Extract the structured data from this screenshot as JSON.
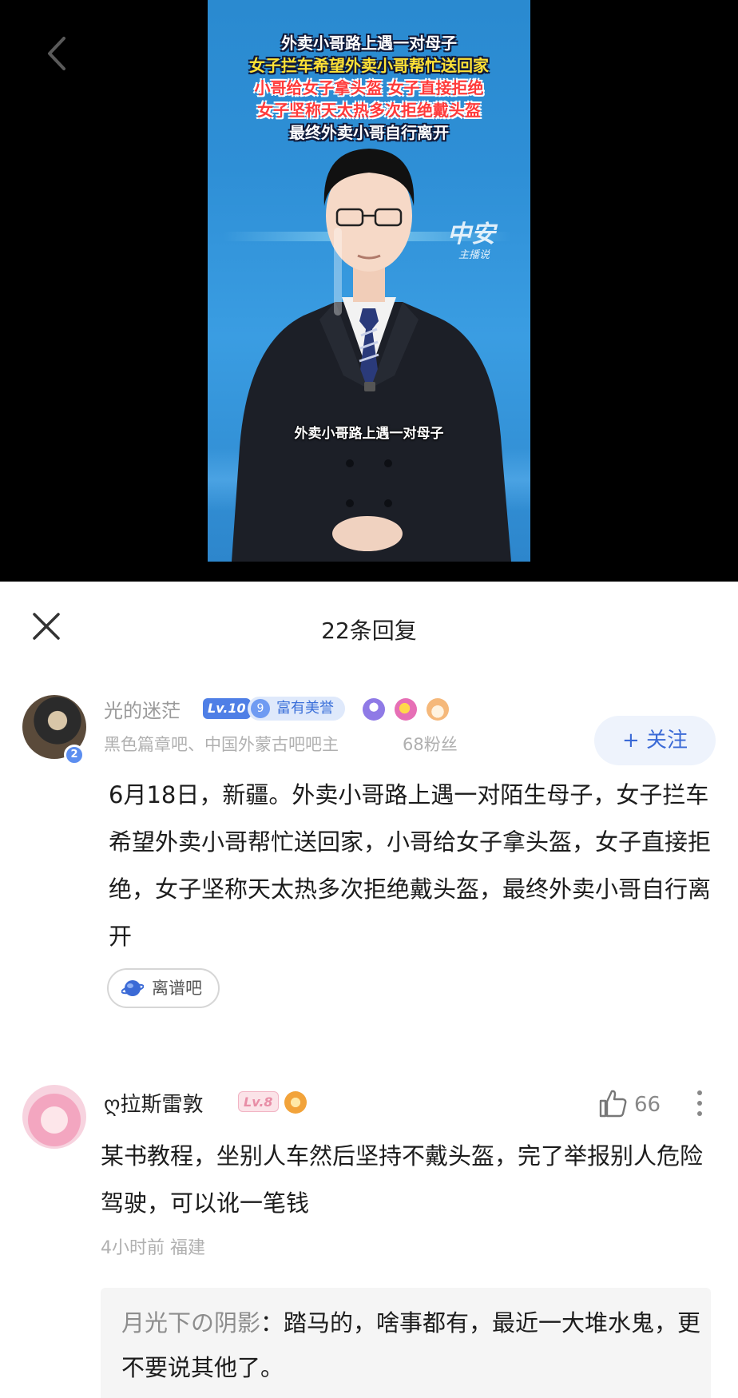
{
  "video": {
    "caption_lines": [
      {
        "text": "外卖小哥路上遇一对母子",
        "color": "white"
      },
      {
        "text": "女子拦车希望外卖小哥帮忙送回家",
        "color": "yellow"
      },
      {
        "text": "小哥给女子拿头盔 女子直接拒绝",
        "color": "red"
      },
      {
        "text": "女子坚称天太热多次拒绝戴头盔",
        "color": "red"
      },
      {
        "text": "最终外卖小哥自行离开",
        "color": "white"
      }
    ],
    "watermark_main": "中安",
    "watermark_sub": "主播说",
    "subtitle": "外卖小哥路上遇一对母子",
    "background_color": "#2e8fd6"
  },
  "panel": {
    "title": "22条回复"
  },
  "original_post": {
    "username": "光的迷茫",
    "level": "Lv.10",
    "honor_number": "9",
    "honor_label": "富有美誉",
    "avatar_badge": "2",
    "sub_info": "黑色篇章吧、中国外蒙古吧吧主",
    "fans": "68粉丝",
    "follow_label": "+ 关注",
    "text": "6月18日，新疆。外卖小哥路上遇一对陌生母子，女子拦车希望外卖小哥帮忙送回家，小哥给女子拿头盔，女子直接拒绝，女子坚称天太热多次拒绝戴头盔，最终外卖小哥自行离开",
    "tag": "离谱吧",
    "accent_color": "#3b6ad6"
  },
  "reply": {
    "username": "ღ拉斯雷敦",
    "level": "Lv.8",
    "likes": "66",
    "text": "某书教程，坐别人车然后坚持不戴头盔，完了举报别人危险驾驶，可以讹一笔钱",
    "meta": "4小时前  福建",
    "sub_reply": {
      "author": "月光下の阴影",
      "separator": "：",
      "text": "踏马的，啥事都有，最近一大堆水鬼，更不要说其他了。"
    }
  }
}
